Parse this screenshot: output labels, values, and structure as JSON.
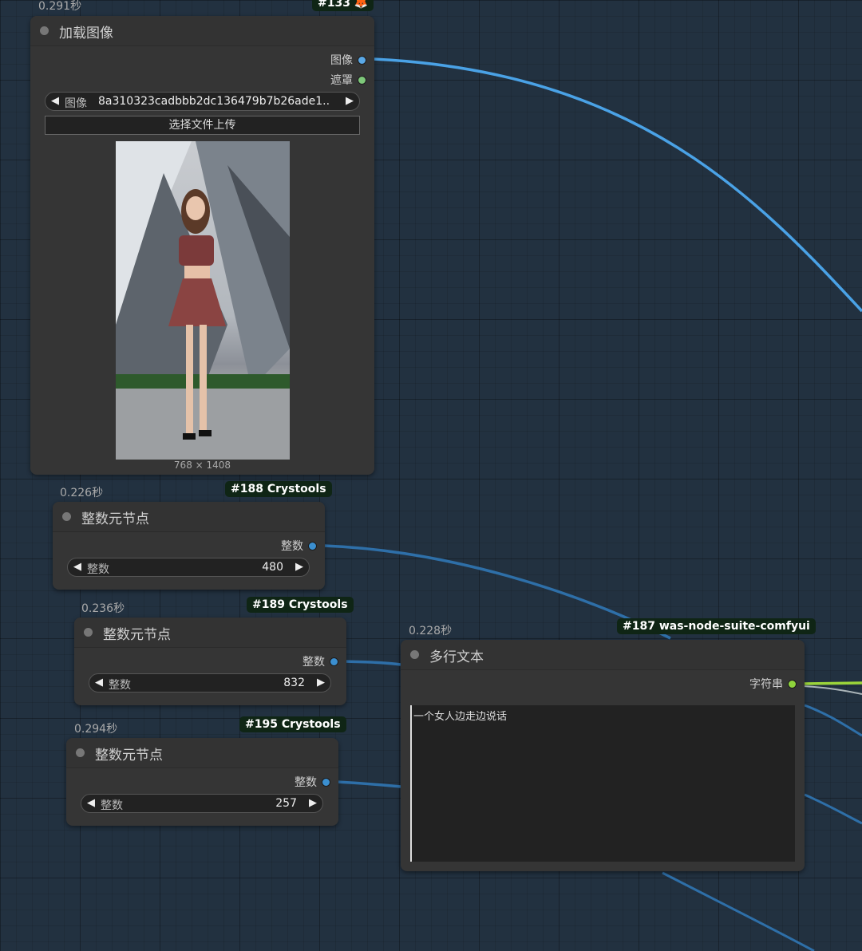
{
  "nodes": {
    "load_image": {
      "timing": "0.291秒",
      "badge": "#133 🦊",
      "title": "加载图像",
      "outputs": [
        "图像",
        "遮罩"
      ],
      "image_widget": {
        "label": "图像",
        "value": "8a310323cadbbb2dc136479b7b26ade1..."
      },
      "upload_label": "选择文件上传",
      "image_size": "768 × 1408"
    },
    "int_188": {
      "timing": "0.226秒",
      "badge": "#188 Crystools",
      "title": "整数元节点",
      "output": "整数",
      "widget": {
        "label": "整数",
        "value": "480"
      }
    },
    "int_189": {
      "timing": "0.236秒",
      "badge": "#189 Crystools",
      "title": "整数元节点",
      "output": "整数",
      "widget": {
        "label": "整数",
        "value": "832"
      }
    },
    "int_195": {
      "timing": "0.294秒",
      "badge": "#195 Crystools",
      "title": "整数元节点",
      "output": "整数",
      "widget": {
        "label": "整数",
        "value": "257"
      }
    },
    "multiline_187": {
      "timing": "0.228秒",
      "badge": "#187 was-node-suite-comfyui",
      "title": "多行文本",
      "output": "字符串",
      "text": "一个女人边走边说话"
    }
  },
  "colors": {
    "image_port": "#5aa8e6",
    "mask_port": "#7ec87a",
    "int_port": "#3b8fd0",
    "string_port": "#8fd43c",
    "wire_blue": "#4a9fe0",
    "wire_green": "#9bd43a"
  }
}
